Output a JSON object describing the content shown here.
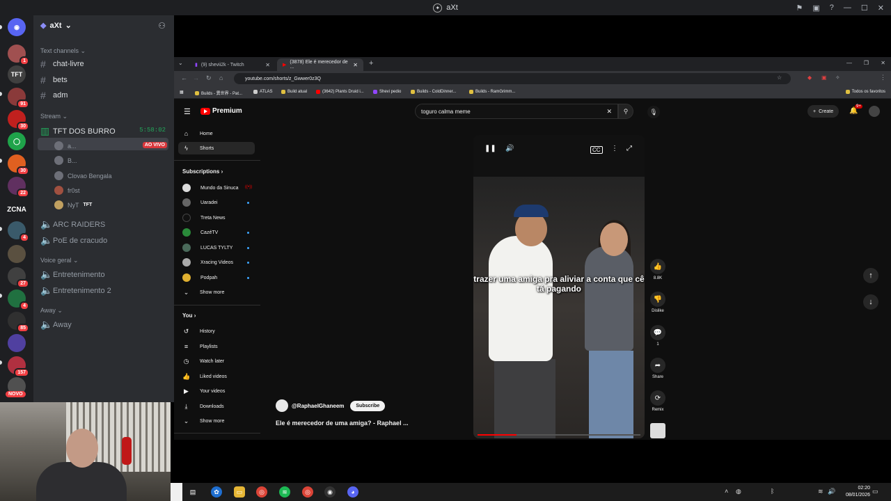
{
  "discord": {
    "window_title": "aXt",
    "server_name": "aXt",
    "categories": {
      "text": "Text channels",
      "stream": "Stream",
      "voice": "Voice geral",
      "away": "Away"
    },
    "text_channels": [
      "chat-livre",
      "bets",
      "adm"
    ],
    "stream_channel": {
      "name": "TFT DOS BURRO",
      "timer": "5:58:02"
    },
    "voice_users": [
      {
        "name": "a...",
        "live": "AO VIVO"
      },
      {
        "name": "B..."
      },
      {
        "name": "Clovao Bengala"
      },
      {
        "name": "fr0st"
      },
      {
        "name": "NyT",
        "tag": "TFT"
      }
    ],
    "other_stream_channels": [
      "ARC RAIDERS",
      "PoE de cracudo"
    ],
    "voice_channels": [
      "Entretenimento",
      "Entretenimento 2"
    ],
    "away_channels": [
      "Away"
    ],
    "server_badges": [
      "1",
      "91",
      "30",
      "30",
      "22",
      "4",
      "27",
      "4",
      "85",
      "157"
    ],
    "server_zcna": "ZCNA",
    "novo": "NOVO"
  },
  "browser": {
    "tabs": [
      {
        "label": "(9) shevii2k - Twitch"
      },
      {
        "label": "(3878) Ele é merecedor de ..."
      }
    ],
    "url": "youtube.com/shorts/z_Gwwer0z3Q",
    "bookmarks": [
      "Builds - 異世界 - Pat...",
      "ATLAS",
      "Build atual",
      "(3642) Plants Druid i...",
      "Shevi pedio",
      "Builds - ColdDinner...",
      "Builds - RamGrimm..."
    ],
    "all_bookmarks": "Todos os favoritos"
  },
  "youtube": {
    "logo": "Premium",
    "search_value": "toguro calma meme",
    "create_label": "Create",
    "notif_badge": "9+",
    "nav": [
      {
        "label": "Home",
        "icon": "home-icon"
      },
      {
        "label": "Shorts",
        "icon": "shorts-icon"
      }
    ],
    "subscriptions_header": "Subscriptions",
    "subscriptions": [
      "Mundo da Sinuca",
      "Uaradei",
      "Treta News",
      "CazéTV",
      "LUCAS TYLTY",
      "Xracing Videos",
      "Podpah"
    ],
    "show_more": "Show more",
    "you_header": "You",
    "you_items": [
      "History",
      "Playlists",
      "Watch later",
      "Liked videos",
      "Your videos",
      "Downloads"
    ],
    "caption": "trazer uma amiga pra aliviar a conta que cê tá pagando",
    "actions": {
      "likes": "8.8K",
      "dislike": "Dislike",
      "comments": "1",
      "share": "Share",
      "remix": "Remix"
    },
    "channel": "@RaphaelGhaneem",
    "subscribe": "Subscribe",
    "video_title": "Ele é merecedor de uma amiga? - Raphael ...",
    "progress": 0.24
  },
  "taskbar": {
    "time": "02:20",
    "date": "08/01/2026"
  }
}
